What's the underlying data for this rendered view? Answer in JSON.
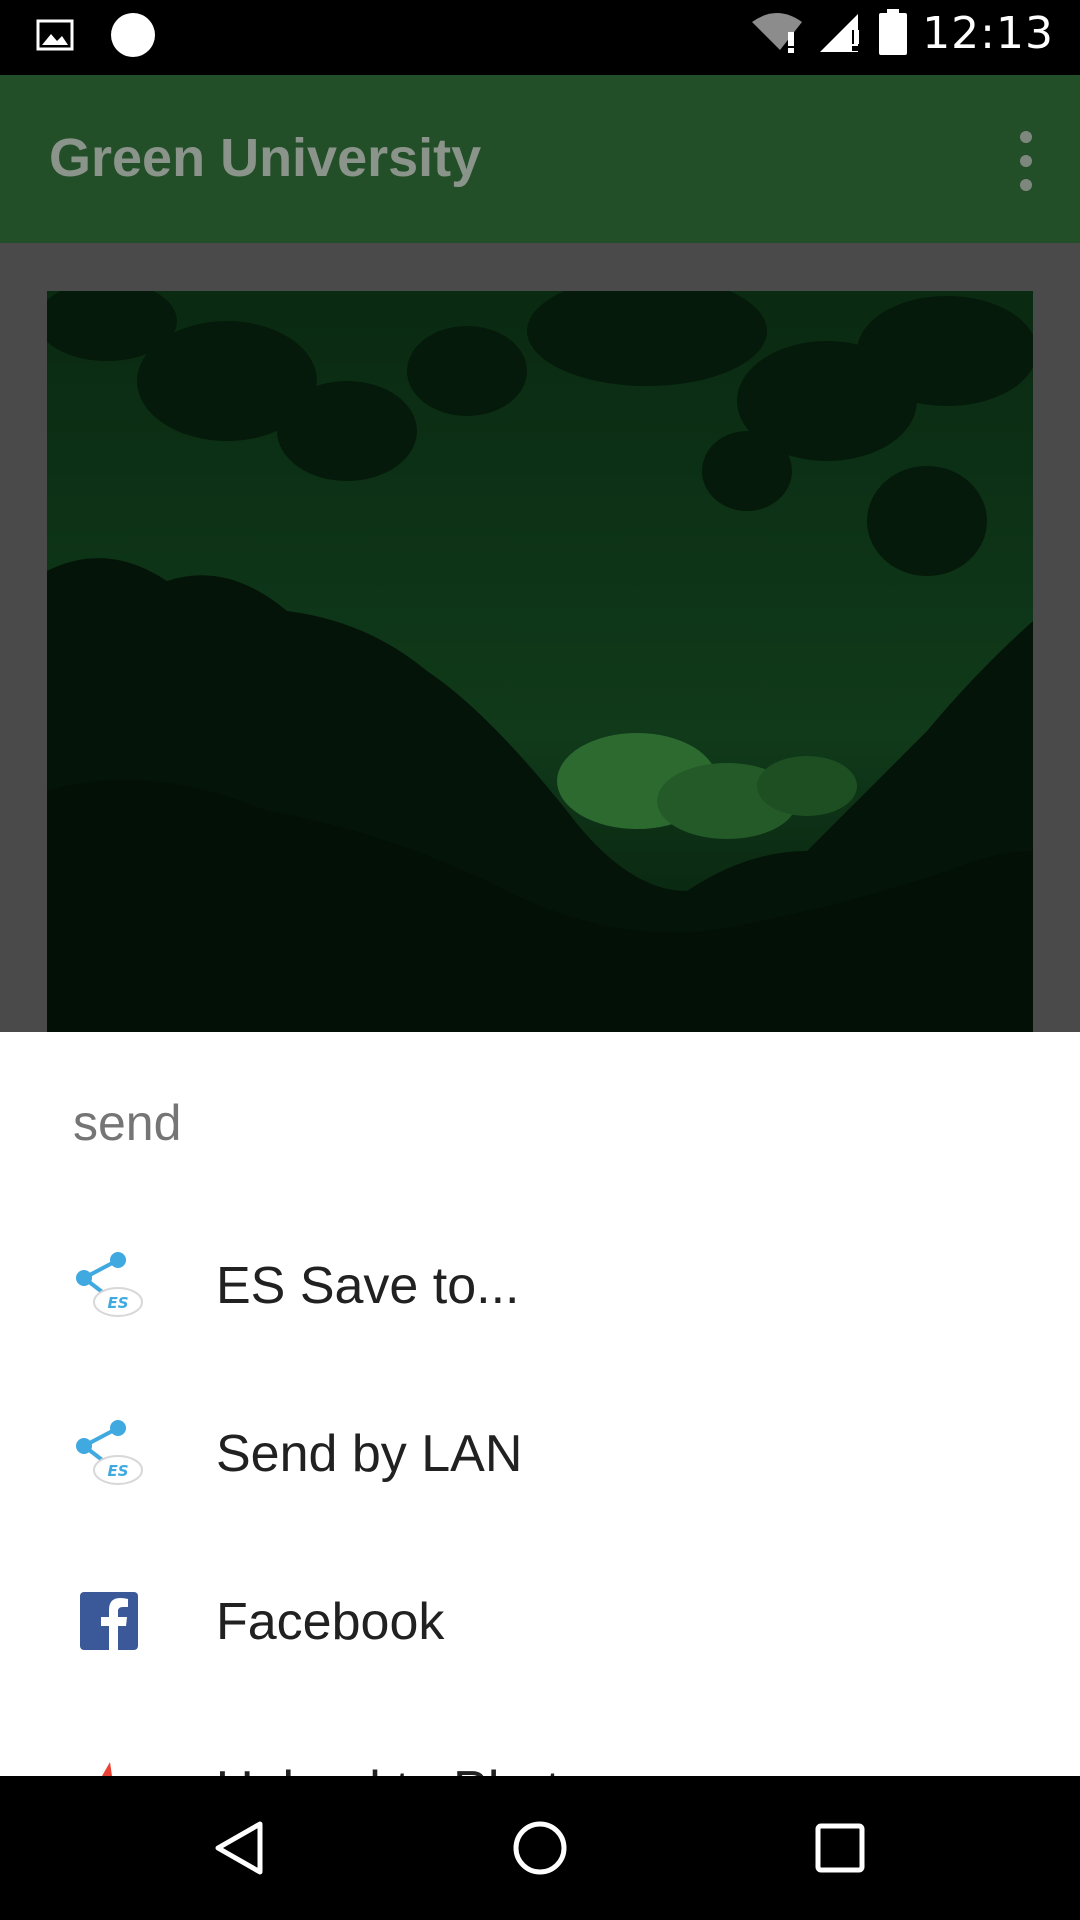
{
  "status_bar": {
    "time": "12:13",
    "icons": [
      "image-notification-icon",
      "circle-notification-icon",
      "wifi-alert-icon",
      "cell-signal-alert-icon",
      "battery-icon"
    ]
  },
  "app_bar": {
    "title": "Green University",
    "menu_icon": "overflow-menu-icon"
  },
  "share_sheet": {
    "title": "send",
    "items": [
      {
        "label": "ES Save to...",
        "icon": "es-share-icon"
      },
      {
        "label": "Send by LAN",
        "icon": "es-share-icon"
      },
      {
        "label": "Facebook",
        "icon": "facebook-icon"
      },
      {
        "label": "Upload to Photos",
        "icon": "photos-icon"
      }
    ]
  },
  "nav_bar": {
    "buttons": [
      "back-icon",
      "home-icon",
      "recents-icon"
    ]
  },
  "colors": {
    "app_bar": "#234f28",
    "es_blue": "#3fa9e0",
    "facebook": "#3b5998"
  }
}
